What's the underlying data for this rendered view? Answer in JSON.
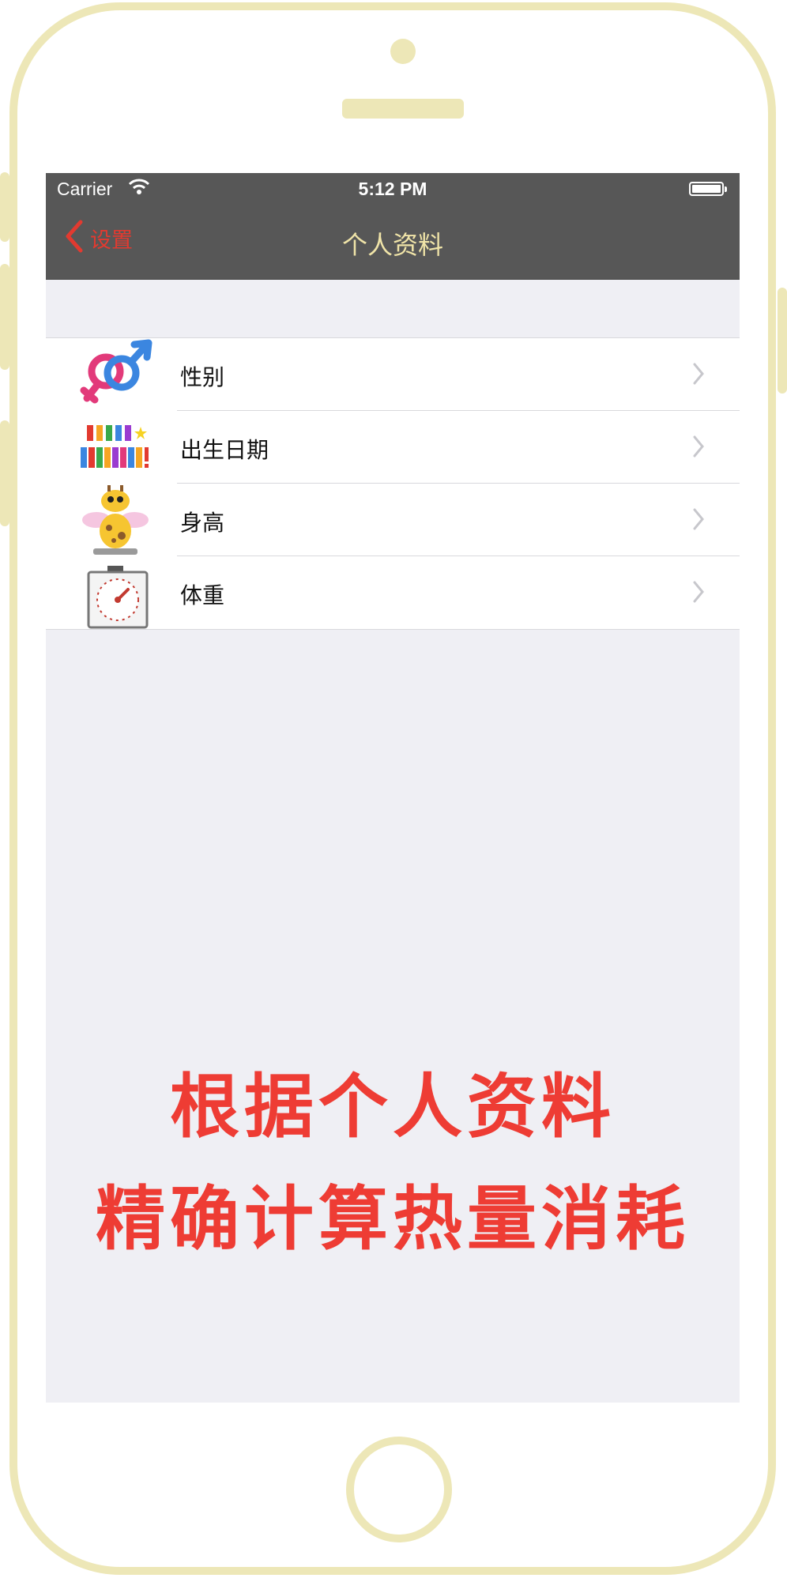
{
  "status_bar": {
    "carrier": "Carrier",
    "time": "5:12 PM"
  },
  "nav": {
    "back_label": "设置",
    "title": "个人资料"
  },
  "rows": [
    {
      "label": "性别",
      "icon": "gender-icon"
    },
    {
      "label": "出生日期",
      "icon": "birthday-icon"
    },
    {
      "label": "身高",
      "icon": "giraffe-height-icon"
    },
    {
      "label": "体重",
      "icon": "scale-weight-icon"
    }
  ],
  "promo": {
    "line1": "根据个人资料",
    "line2": "精确计算热量消耗"
  },
  "colors": {
    "nav_bg": "#575757",
    "accent_red": "#e23a30",
    "title_yellow": "#f0e4a8",
    "frame": "#ede7b7",
    "promo_red": "#ee3c34"
  }
}
